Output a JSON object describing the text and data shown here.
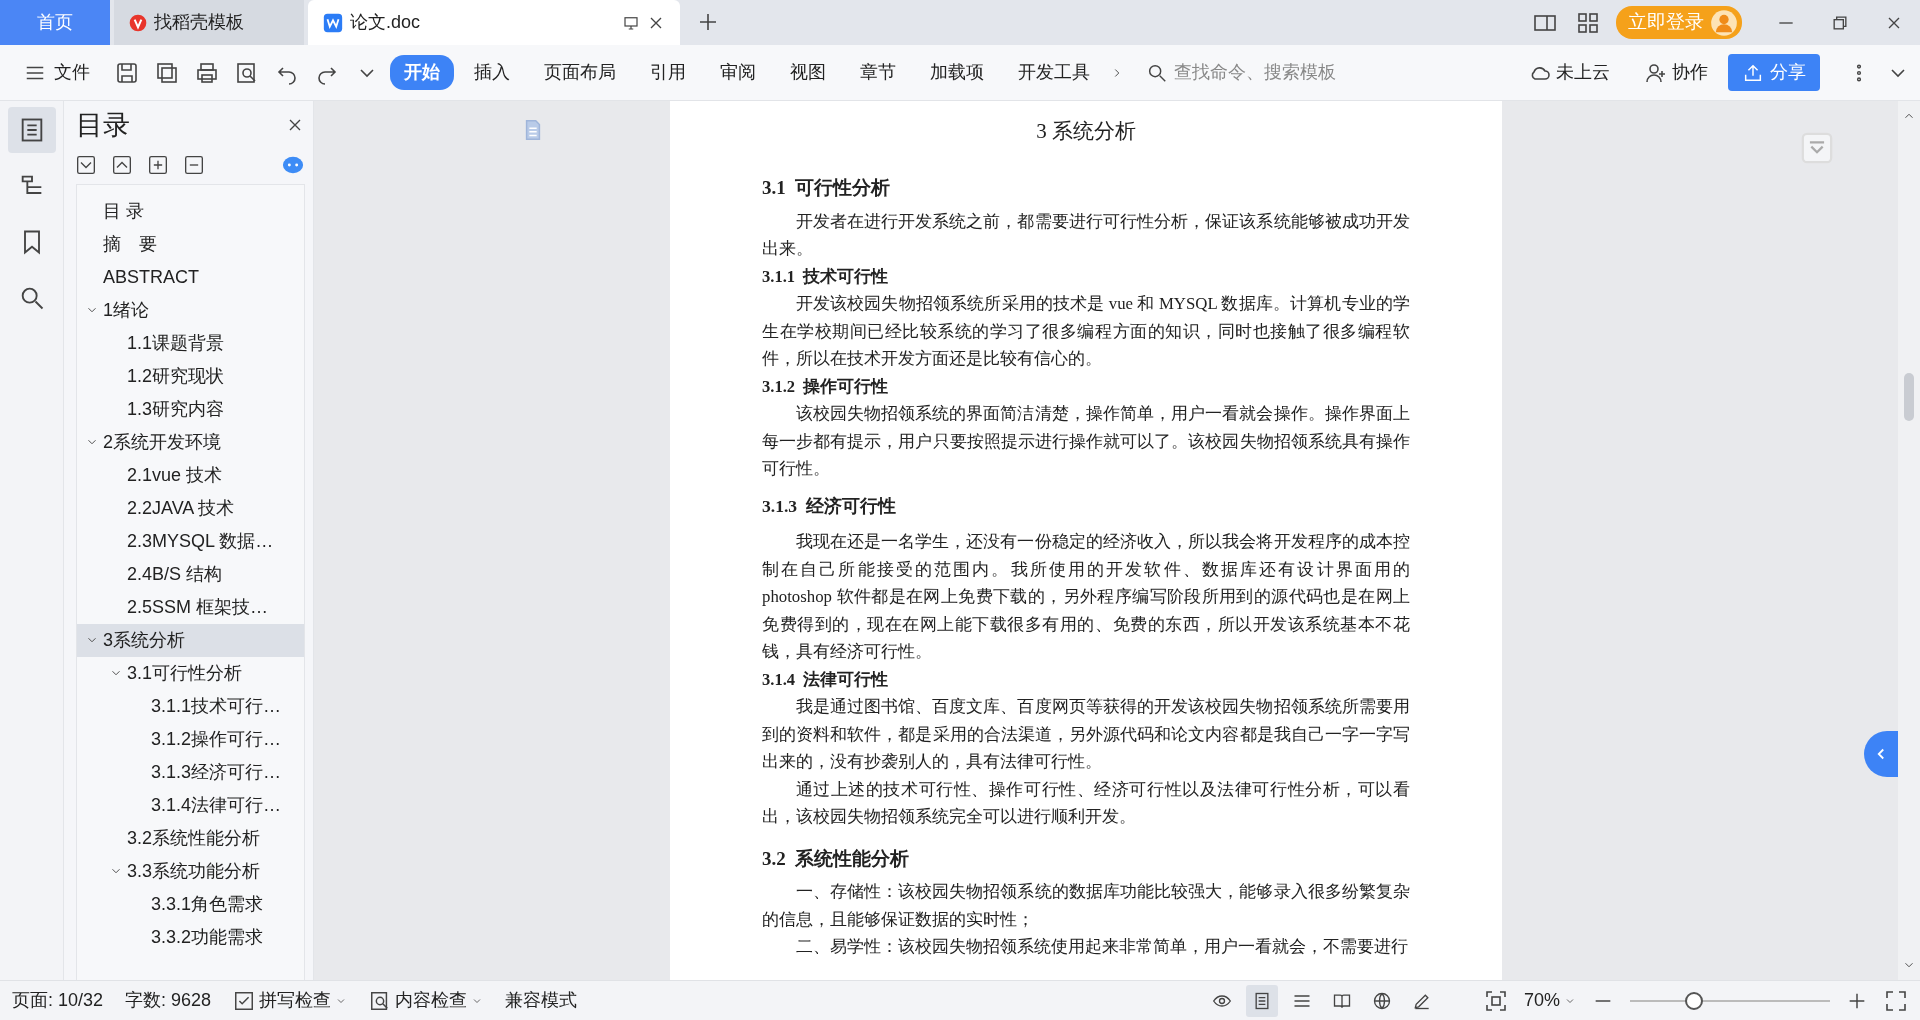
{
  "tabs": [
    {
      "label": "首页",
      "kind": "home",
      "selected": false
    },
    {
      "label": "找稻壳模板",
      "kind": "docer",
      "selected": false
    },
    {
      "label": "论文.doc",
      "kind": "doc",
      "selected": true
    }
  ],
  "login": {
    "label": "立即登录"
  },
  "toolbar": {
    "file_menu": "文件",
    "ribbon_tabs": [
      {
        "label": "开始",
        "selected": true
      },
      {
        "label": "插入",
        "selected": false
      },
      {
        "label": "页面布局",
        "selected": false
      },
      {
        "label": "引用",
        "selected": false
      },
      {
        "label": "审阅",
        "selected": false
      },
      {
        "label": "视图",
        "selected": false
      },
      {
        "label": "章节",
        "selected": false
      },
      {
        "label": "加载项",
        "selected": false
      },
      {
        "label": "开发工具",
        "selected": false
      }
    ],
    "search": {
      "placeholder": "查找命令、搜索模板"
    },
    "cloud": "未上云",
    "collab": "协作",
    "share": "分享"
  },
  "rail": [
    {
      "kind": "toc",
      "selected": true
    },
    {
      "kind": "outline",
      "selected": false
    },
    {
      "kind": "bookmark",
      "selected": false
    },
    {
      "kind": "search",
      "selected": false
    }
  ],
  "toc": {
    "title": "目录",
    "items": [
      {
        "label": "目 录"
      },
      {
        "label": "摘　要"
      },
      {
        "label": "ABSTRACT"
      },
      {
        "label": "1绪论",
        "expanded": true,
        "children": [
          {
            "label": "1.1课题背景"
          },
          {
            "label": "1.2研究现状"
          },
          {
            "label": "1.3研究内容"
          }
        ]
      },
      {
        "label": "2系统开发环境",
        "expanded": true,
        "children": [
          {
            "label": "2.1vue 技术"
          },
          {
            "label": "2.2JAVA 技术"
          },
          {
            "label": "2.3MYSQL 数据…"
          },
          {
            "label": "2.4B/S 结构"
          },
          {
            "label": "2.5SSM 框架技…"
          }
        ]
      },
      {
        "label": "3系统分析",
        "expanded": true,
        "selected": true,
        "children": [
          {
            "label": "3.1可行性分析",
            "expanded": true,
            "children": [
              {
                "label": "3.1.1技术可行…"
              },
              {
                "label": "3.1.2操作可行…"
              },
              {
                "label": "3.1.3经济可行…"
              },
              {
                "label": "3.1.4法律可行…"
              }
            ]
          },
          {
            "label": "3.2系统性能分析"
          },
          {
            "label": "3.3系统功能分析",
            "expanded": true,
            "children": [
              {
                "label": "3.3.1角色需求"
              },
              {
                "label": "3.3.2功能需求"
              }
            ]
          }
        ]
      }
    ]
  },
  "document": {
    "blocks": [
      {
        "kind": "h1",
        "num": "3",
        "text": "系统分析"
      },
      {
        "kind": "h2",
        "num": "3.1",
        "text": "可行性分析"
      },
      {
        "kind": "p",
        "text": "开发者在进行开发系统之前，都需要进行可行性分析，保证该系统能够被成功开发出来。"
      },
      {
        "kind": "h3",
        "num": "3.1.1",
        "text": "技术可行性"
      },
      {
        "kind": "p",
        "text": "开发该校园失物招领系统所采用的技术是 vue 和 MYSQL 数据库。计算机专业的学生在学校期间已经比较系统的学习了很多编程方面的知识，同时也接触了很多编程软件，所以在技术开发方面还是比较有信心的。"
      },
      {
        "kind": "h3",
        "num": "3.1.2",
        "text": "操作可行性"
      },
      {
        "kind": "p",
        "text": "该校园失物招领系统的界面简洁清楚，操作简单，用户一看就会操作。操作界面上每一步都有提示，用户只要按照提示进行操作就可以了。该校园失物招领系统具有操作可行性。"
      },
      {
        "kind": "h3b",
        "num": "3.1.3",
        "text": "经济可行性"
      },
      {
        "kind": "p",
        "text": "我现在还是一名学生，还没有一份稳定的经济收入，所以我会将开发程序的成本控制在自己所能接受的范围内。我所使用的开发软件、数据库还有设计界面用的 photoshop 软件都是在网上免费下载的，另外程序编写阶段所用到的源代码也是在网上免费得到的，现在在网上能下载很多有用的、免费的东西，所以开发该系统基本不花钱，具有经济可行性。"
      },
      {
        "kind": "h3",
        "num": "3.1.4",
        "text": "法律可行性"
      },
      {
        "kind": "p",
        "text": "我是通过图书馆、百度文库、百度网页等获得的开发该校园失物招领系统所需要用到的资料和软件，都是采用的合法渠道，另外源代码和论文内容都是我自己一字一字写出来的，没有抄袭别人的，具有法律可行性。"
      },
      {
        "kind": "p",
        "text": "通过上述的技术可行性、操作可行性、经济可行性以及法律可行性分析，可以看出，该校园失物招领系统完全可以进行顺利开发。"
      },
      {
        "kind": "h2",
        "num": "3.2",
        "text": "系统性能分析"
      },
      {
        "kind": "p",
        "text": "一、存储性：该校园失物招领系统的数据库功能比较强大，能够录入很多纷繁复杂的信息，且能够保证数据的实时性；"
      },
      {
        "kind": "p",
        "text": "二、易学性：该校园失物招领系统使用起来非常简单，用户一看就会，不需要进行"
      }
    ]
  },
  "status_bar": {
    "page": "页面: 10/32",
    "words": "字数: 9628",
    "spell": "拼写检查",
    "content": "内容检查",
    "mode": "兼容模式",
    "views": [
      {
        "kind": "eye",
        "selected": false
      },
      {
        "kind": "page",
        "selected": true
      },
      {
        "kind": "outline",
        "selected": false
      },
      {
        "kind": "read",
        "selected": false
      },
      {
        "kind": "web",
        "selected": false
      },
      {
        "kind": "pen",
        "selected": false
      }
    ],
    "zoom": {
      "reading": "70%",
      "level": 0.3
    }
  }
}
